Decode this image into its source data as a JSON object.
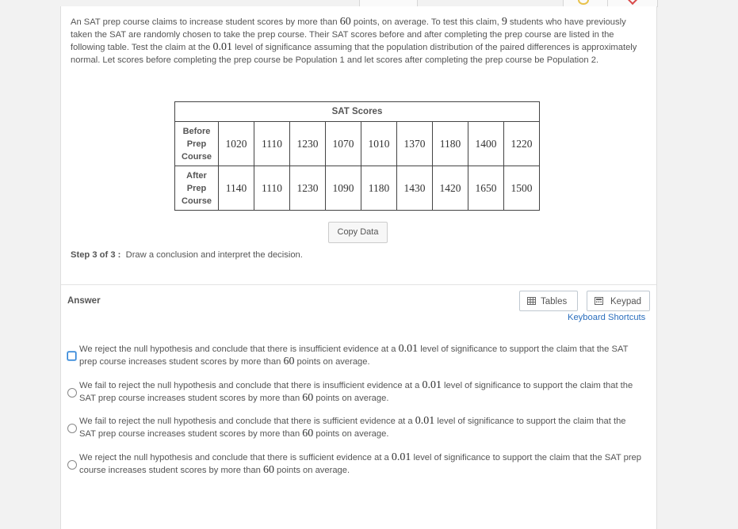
{
  "question": {
    "p1": "An SAT prep course claims to increase student scores by more than ",
    "n1": "60",
    "p2": " points, on average. To test this claim, ",
    "n2": "9",
    "p3": " students who have previously taken the SAT are randomly chosen to take the prep course. Their SAT scores before and after completing the prep course are listed in the following table. Test the claim at the ",
    "n3": "0.01",
    "p4": " level of significance assuming that the population distribution of the paired differences is approximately normal. Let scores before completing the prep course be Population 1 and let scores after completing the prep course be Population 2."
  },
  "table": {
    "title": "SAT Scores",
    "before_label": [
      "Before",
      "Prep",
      "Course"
    ],
    "after_label": [
      "After",
      "Prep",
      "Course"
    ],
    "before": [
      "1020",
      "1110",
      "1230",
      "1070",
      "1010",
      "1370",
      "1180",
      "1400",
      "1220"
    ],
    "after": [
      "1140",
      "1110",
      "1230",
      "1090",
      "1180",
      "1430",
      "1420",
      "1650",
      "1500"
    ]
  },
  "copy_data_label": "Copy Data",
  "step": {
    "label": "Step 3 of 3 :",
    "text": "Draw a conclusion and interpret the decision."
  },
  "answer_label": "Answer",
  "tables_button": "Tables",
  "keypad_button": "Keypad",
  "keyboard_shortcuts": "Keyboard Shortcuts",
  "options": [
    {
      "a": "We reject the null hypothesis and conclude that there is insufficient evidence at a ",
      "alpha": "0.01",
      "b": " level of significance to support the claim that the SAT prep course increases student scores by more than ",
      "pts": "60",
      "c": " points on average."
    },
    {
      "a": "We fail to reject the null hypothesis and conclude that there is insufficient evidence at a ",
      "alpha": "0.01",
      "b": " level of significance to support the claim that the SAT prep course increases student scores by more than ",
      "pts": "60",
      "c": " points on average."
    },
    {
      "a": "We fail to reject the null hypothesis and conclude that there is sufficient evidence at a ",
      "alpha": "0.01",
      "b": " level of significance to support the claim that the SAT prep course increases student scores by more than ",
      "pts": "60",
      "c": " points on average."
    },
    {
      "a": "We reject the null hypothesis and conclude that there is sufficient evidence at a ",
      "alpha": "0.01",
      "b": " level of significance to support the claim that the SAT prep course increases student scores by more than ",
      "pts": "60",
      "c": " points on average."
    }
  ],
  "selected_option": 0,
  "colors": {
    "link": "#2a6ebd",
    "focus": "#2a7fd4"
  }
}
